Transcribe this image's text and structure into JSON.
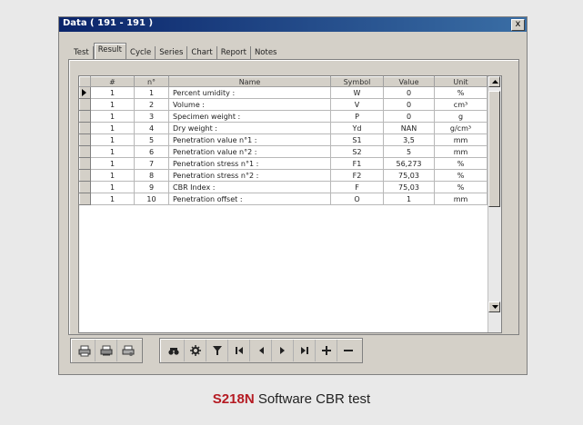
{
  "window": {
    "title": "Data ( 191 - 191 )",
    "close_label": "x"
  },
  "tabs": [
    {
      "label": "Test",
      "active": false
    },
    {
      "label": "Result",
      "active": true
    },
    {
      "label": "Cycle",
      "active": false
    },
    {
      "label": "Series",
      "active": false
    },
    {
      "label": "Chart",
      "active": false
    },
    {
      "label": "Report",
      "active": false
    },
    {
      "label": "Notes",
      "active": false
    }
  ],
  "table": {
    "columns": [
      "#",
      "n°",
      "Name",
      "Symbol",
      "Value",
      "Unit"
    ],
    "rows": [
      {
        "hash": "1",
        "n": "1",
        "name": "Percent umidity :",
        "symbol": "W",
        "value": "0",
        "unit": "%"
      },
      {
        "hash": "1",
        "n": "2",
        "name": "Volume :",
        "symbol": "V",
        "value": "0",
        "unit": "cm³"
      },
      {
        "hash": "1",
        "n": "3",
        "name": "Specimen weight :",
        "symbol": "P",
        "value": "0",
        "unit": "g"
      },
      {
        "hash": "1",
        "n": "4",
        "name": "Dry weight :",
        "symbol": "Yd",
        "value": "NAN",
        "unit": "g/cm³"
      },
      {
        "hash": "1",
        "n": "5",
        "name": "Penetration value n°1 :",
        "symbol": "S1",
        "value": "3,5",
        "unit": "mm"
      },
      {
        "hash": "1",
        "n": "6",
        "name": "Penetration value n°2 :",
        "symbol": "S2",
        "value": "5",
        "unit": "mm"
      },
      {
        "hash": "1",
        "n": "7",
        "name": "Penetration stress n°1 :",
        "symbol": "F1",
        "value": "56,273",
        "unit": "%"
      },
      {
        "hash": "1",
        "n": "8",
        "name": "Penetration stress n°2 :",
        "symbol": "F2",
        "value": "75,03",
        "unit": "%"
      },
      {
        "hash": "1",
        "n": "9",
        "name": "CBR Index :",
        "symbol": "F",
        "value": "75,03",
        "unit": "%"
      },
      {
        "hash": "1",
        "n": "10",
        "name": "Penetration offset :",
        "symbol": "O",
        "value": "1",
        "unit": "mm"
      }
    ]
  },
  "toolbar": {
    "print_group": [
      "print-icon",
      "print-preview-icon",
      "printer-setup-icon"
    ],
    "nav_group": [
      "find-icon",
      "settings-icon",
      "filter-icon",
      "first-record-icon",
      "prev-record-icon",
      "next-record-icon",
      "last-record-icon",
      "add-icon",
      "remove-icon"
    ]
  },
  "caption": {
    "model": "S218N",
    "text": " Software CBR test"
  }
}
